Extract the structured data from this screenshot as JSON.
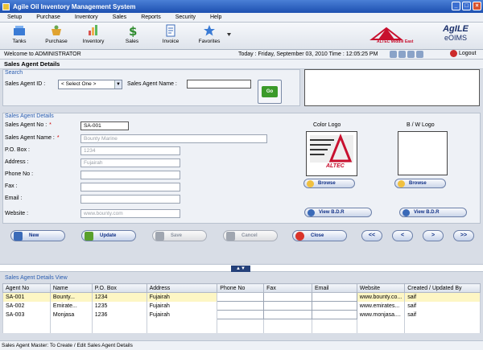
{
  "window": {
    "title": "Agile Oil Inventory Management System",
    "minimize": "_",
    "maximize": "□",
    "close": "×"
  },
  "menu": [
    "Setup",
    "Purchase",
    "Inventory",
    "Sales",
    "Reports",
    "Security",
    "Help"
  ],
  "toolbar": [
    {
      "label": "Tanks",
      "icon": "tanks-icon"
    },
    {
      "label": "Purchase",
      "icon": "purchase-icon"
    },
    {
      "label": "Inventory",
      "icon": "inventory-icon"
    },
    {
      "label": "Sales",
      "icon": "sales-icon"
    },
    {
      "label": "Invoice",
      "icon": "invoice-icon"
    },
    {
      "label": "Favorites",
      "icon": "favorites-icon"
    }
  ],
  "brand": {
    "altec_caption": "ALTEC Middle East",
    "agile": "AgILE",
    "eoims": "eOIMS"
  },
  "welcome": {
    "text": "Welcome to ADMINISTRATOR",
    "today": "Today : Friday, September 03, 2010  Time : 12:05:25 PM",
    "logout": "Logout"
  },
  "page_title": "Sales Agent Details",
  "search": {
    "section": "Search",
    "agent_id_label": "Sales Agent ID :",
    "agent_id_value": "< Select One >",
    "agent_name_label": "Sales Agent Name :",
    "agent_name_value": "",
    "go": "Go"
  },
  "details": {
    "section": "Sales Agent Details",
    "fields": [
      {
        "label": "Sales Agent No :",
        "value": "SA-001",
        "required": "*"
      },
      {
        "label": "Sales Agent Name :",
        "value": "Bounty Marine",
        "required": "*"
      },
      {
        "label": "P.O. Box :",
        "value": "1234",
        "required": ""
      },
      {
        "label": "Address :",
        "value": "Fujairah",
        "required": ""
      },
      {
        "label": "Phone No :",
        "value": "",
        "required": ""
      },
      {
        "label": "Fax :",
        "value": "",
        "required": ""
      },
      {
        "label": "Email :",
        "value": "",
        "required": ""
      },
      {
        "label": "Website :",
        "value": "www.bounty.com",
        "required": ""
      }
    ],
    "color_logo": "Color Logo",
    "bw_logo": "B / W Logo",
    "logo_text": "ALTEC",
    "browse": "Browse",
    "view_bdr": "View B.D.R"
  },
  "actions": {
    "new": "New",
    "update": "Update",
    "save": "Save",
    "cancel": "Cancel",
    "close": "Close",
    "first": "<<",
    "prev": "<",
    "next": ">",
    "last": ">>"
  },
  "splitter_grip": "▲▼",
  "view": {
    "section": "Sales Agent Details View",
    "columns": [
      "Agent No",
      "Name",
      "P.O. Box",
      "Address",
      "Phone No",
      "Fax",
      "Email",
      "Website",
      "Created / Updated By"
    ],
    "rows": [
      [
        "SA-001",
        "Bounty...",
        "1234",
        "Fujairah",
        "",
        "",
        "",
        "www.bounty.co...",
        "saif"
      ],
      [
        "SA-002",
        "Emirate...",
        "1235",
        "Fujairah",
        "",
        "",
        "",
        "www.emirates...",
        "saif"
      ],
      [
        "SA-003",
        "Monjasa",
        "1236",
        "Fujairah",
        "",
        "",
        "",
        "www.monjasa....",
        "saif"
      ]
    ]
  },
  "status": "Sales Agent Master: To Create / Edit Sales Agent Details",
  "colors": {
    "title": "#1d4fb0",
    "section": "#2a5db0",
    "highlight": "#fdf6c4",
    "button_text": "#0e2f86"
  }
}
